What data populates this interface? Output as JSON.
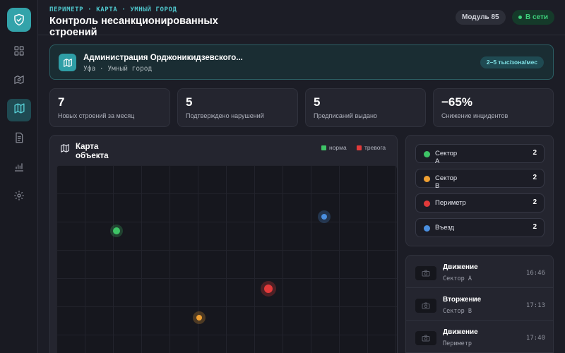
{
  "header": {
    "breadcrumb": "ПЕРИМЕТР · КАРТА · УМНЫЙ ГОРОД",
    "title": "Контроль несанкционированных строений",
    "module_badge": "Модуль 85",
    "status_badge": "В сети"
  },
  "sidebar": {
    "items": [
      {
        "icon": "dashboard-icon",
        "active": false
      },
      {
        "icon": "camera-map-icon",
        "active": false
      },
      {
        "icon": "map-icon",
        "active": true
      },
      {
        "icon": "document-icon",
        "active": false
      },
      {
        "icon": "bar-chart-icon",
        "active": false
      },
      {
        "icon": "gear-icon",
        "active": false
      }
    ]
  },
  "banner": {
    "title": "Администрация Орджоникидзевского...",
    "subtitle": "Уфа · Умный город",
    "pill": "2–5 тыс/зона/мес"
  },
  "stats": [
    {
      "value": "7",
      "label": "Новых строений за месяц"
    },
    {
      "value": "5",
      "label": "Подтверждено нарушений"
    },
    {
      "value": "5",
      "label": "Предписаний выдано"
    },
    {
      "value": "−65%",
      "label": "Снижение инцидентов"
    }
  ],
  "map": {
    "title": "Карта объекта",
    "legend": [
      {
        "label": "норма",
        "color": "#3ec466"
      },
      {
        "label": "тревога",
        "color": "#e23a3a"
      }
    ],
    "markers": [
      {
        "name": "marker-green",
        "color": "#3ec466"
      },
      {
        "name": "marker-blue",
        "color": "#4a8fe0"
      },
      {
        "name": "marker-red",
        "color": "#e23a3a"
      },
      {
        "name": "marker-orange",
        "color": "#f0a032"
      }
    ]
  },
  "sectors": [
    {
      "name": "Сектор А",
      "count": "2",
      "color": "#3ec466"
    },
    {
      "name": "Сектор В",
      "count": "2",
      "color": "#f0a032"
    },
    {
      "name": "Периметр",
      "count": "2",
      "color": "#e23a3a"
    },
    {
      "name": "Въезд",
      "count": "2",
      "color": "#4a8fe0"
    }
  ],
  "events": [
    {
      "title": "Движение",
      "subtitle": "Сектор А",
      "time": "16:46"
    },
    {
      "title": "Вторжение",
      "subtitle": "Сектор В",
      "time": "17:13"
    },
    {
      "title": "Движение",
      "subtitle": "Периметр",
      "time": "17:40"
    }
  ]
}
